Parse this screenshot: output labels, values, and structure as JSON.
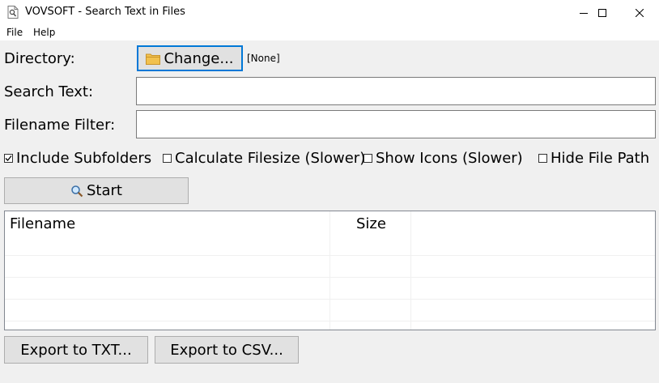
{
  "window": {
    "title": "VOVSOFT - Search Text in Files",
    "controls": [
      "minimize",
      "maximize",
      "close"
    ]
  },
  "menu": {
    "items": [
      {
        "label": "File"
      },
      {
        "label": "Help"
      }
    ]
  },
  "directory": {
    "label": "Directory:",
    "change_button": "Change...",
    "current_value": "[None]"
  },
  "search_text": {
    "label": "Search Text:",
    "value": ""
  },
  "filename_filter": {
    "label": "Filename Filter:",
    "value": ""
  },
  "options": [
    {
      "label": "Include Subfolders",
      "checked": true
    },
    {
      "label": "Calculate Filesize (Slower)",
      "checked": false
    },
    {
      "label": "Show Icons (Slower)",
      "checked": false
    },
    {
      "label": "Hide File Path",
      "checked": false
    }
  ],
  "start_button": "Start",
  "results": {
    "columns": [
      "Filename",
      "Size"
    ],
    "rows": []
  },
  "export": {
    "txt_button": "Export to TXT...",
    "csv_button": "Export to CSV..."
  },
  "colors": {
    "client_bg": "#f0f0f0",
    "button_bg": "#e1e1e1",
    "focus_border": "#0078d7",
    "folder_icon": "#f2c14e"
  }
}
